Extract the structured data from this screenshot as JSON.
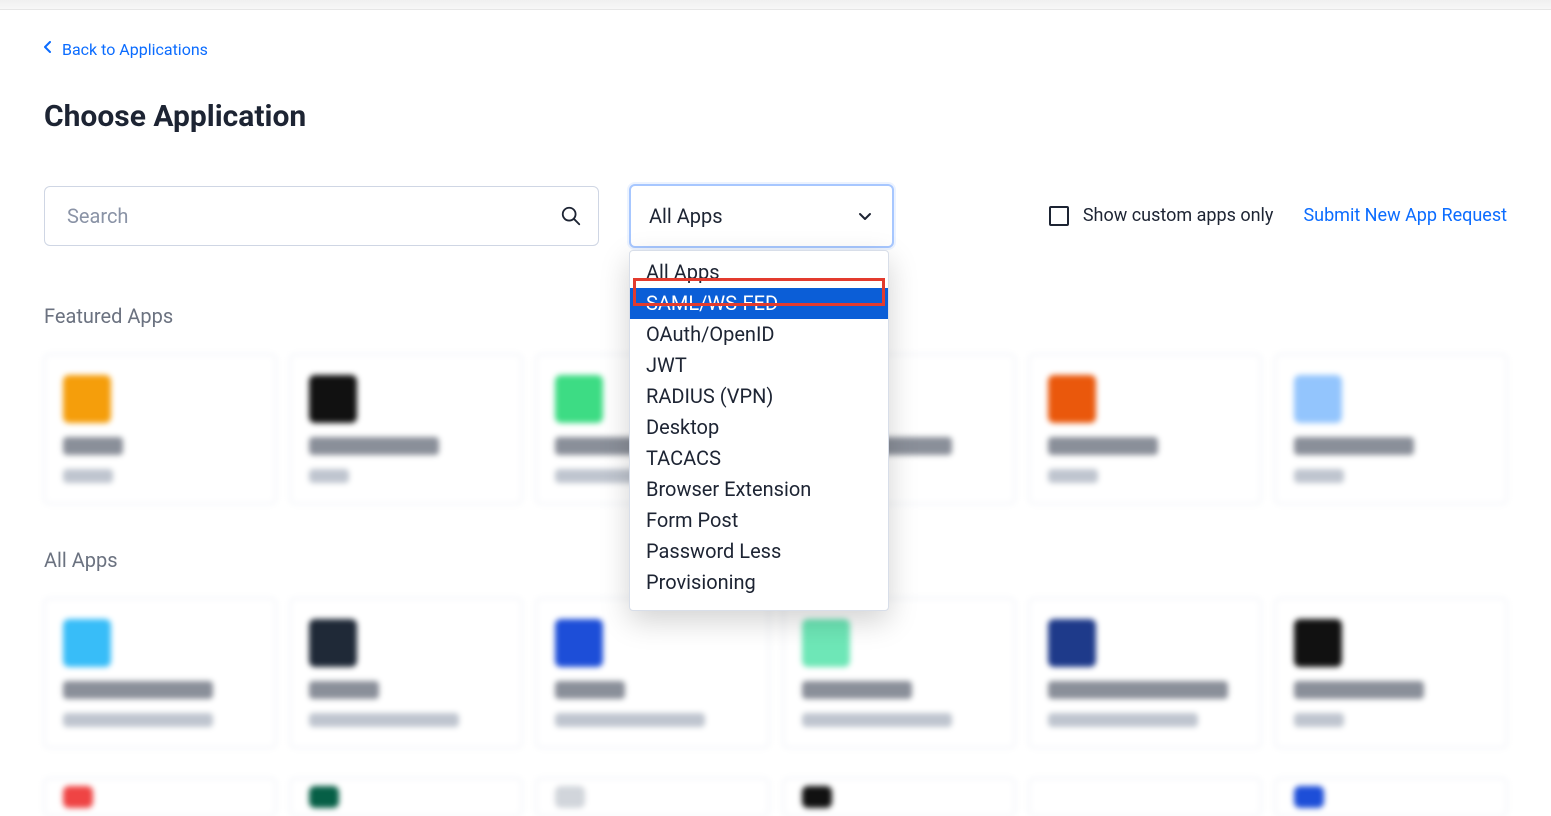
{
  "back_link": {
    "label": "Back to Applications"
  },
  "page": {
    "title": "Choose Application"
  },
  "search": {
    "placeholder": "Search"
  },
  "filter": {
    "selected": "All Apps",
    "highlighted": "SAML/WS-FED",
    "options": [
      "All Apps",
      "SAML/WS-FED",
      "OAuth/OpenID",
      "JWT",
      "RADIUS (VPN)",
      "Desktop",
      "TACACS",
      "Browser Extension",
      "Form Post",
      "Password Less",
      "Provisioning"
    ]
  },
  "show_custom": {
    "label": "Show custom apps only",
    "checked": false
  },
  "submit_link": {
    "label": "Submit New App Request"
  },
  "sections": {
    "featured": {
      "title": "Featured Apps",
      "cards": [
        {
          "icon_color": "#f59e0b",
          "name_w": 60,
          "cat_w": 50
        },
        {
          "icon_color": "#111111",
          "name_w": 130,
          "cat_w": 40
        },
        {
          "icon_color": "#3ddc84",
          "name_w": 120,
          "cat_w": 100
        },
        {
          "icon_color": "#9ca3af",
          "name_w": 150,
          "cat_w": 80
        },
        {
          "icon_color": "#ea580c",
          "name_w": 110,
          "cat_w": 50
        },
        {
          "icon_color": "#93c5fd",
          "name_w": 120,
          "cat_w": 50
        }
      ]
    },
    "all": {
      "title": "All Apps",
      "cards": [
        {
          "icon_color": "#38bdf8",
          "name_w": 150,
          "cat_w": 150
        },
        {
          "icon_color": "#1f2937",
          "name_w": 70,
          "cat_w": 150
        },
        {
          "icon_color": "#1d4ed8",
          "name_w": 70,
          "cat_w": 150
        },
        {
          "icon_color": "#6ee7b7",
          "name_w": 110,
          "cat_w": 150
        },
        {
          "icon_color": "#1e3a8a",
          "name_w": 180,
          "cat_w": 150
        },
        {
          "icon_color": "#111111",
          "name_w": 130,
          "cat_w": 50
        }
      ],
      "cards_row3": [
        {
          "icon_color": "#ef4444"
        },
        {
          "icon_color": "#065f46"
        },
        {
          "icon_color": "#d1d5db"
        },
        {
          "icon_color": "#111111"
        },
        {
          "icon_color": "#ffffff"
        },
        {
          "icon_color": "#1d4ed8"
        }
      ]
    }
  }
}
